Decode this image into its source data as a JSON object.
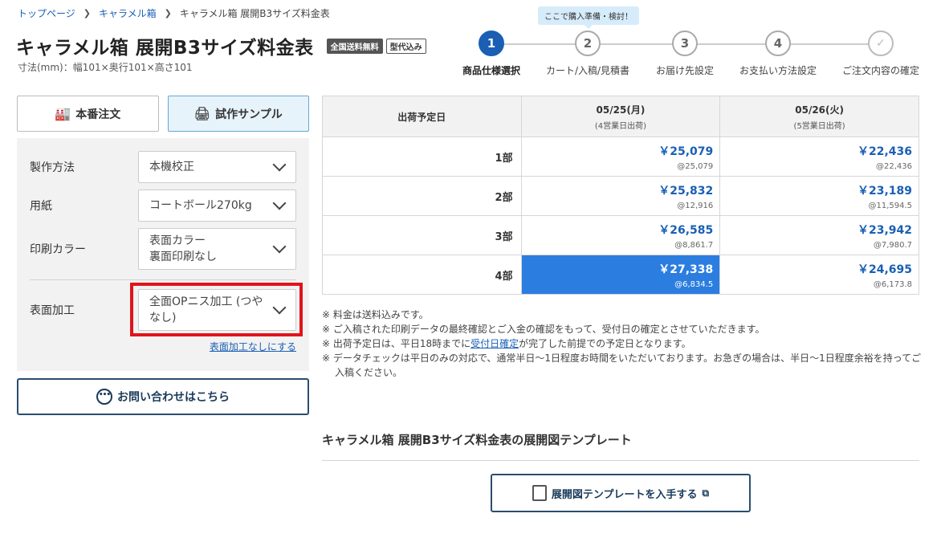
{
  "breadcrumb": {
    "items": [
      "トップページ",
      "キャラメル箱",
      "キャラメル箱 展開B3サイズ料金表"
    ]
  },
  "header": {
    "title": "キャラメル箱 展開B3サイズ料金表",
    "badge_free_shipping": "全国送料無料",
    "badge_die_included": "型代込み",
    "dimension": "寸法(mm)：幅101×奥行101×高さ101"
  },
  "steps": {
    "note": "ここで購入準備・検討！",
    "items": [
      {
        "number": "1",
        "label": "商品仕様選択",
        "state": "active"
      },
      {
        "number": "2",
        "label": "カート/入稿/見積書",
        "state": "pending"
      },
      {
        "number": "3",
        "label": "お届け先設定",
        "state": "pending"
      },
      {
        "number": "4",
        "label": "お支払い方法設定",
        "state": "pending"
      },
      {
        "number": "✓",
        "label": "ご注文内容の確定",
        "state": "final"
      }
    ]
  },
  "mode_tabs": {
    "production": "本番注文",
    "sample": "試作サンプル",
    "selected": "sample"
  },
  "spec": {
    "method": {
      "label": "製作方法",
      "value": "本機校正"
    },
    "paper": {
      "label": "用紙",
      "value": "コートボール270kg"
    },
    "color": {
      "label": "印刷カラー",
      "value_line1": "表面カラー",
      "value_line2": "裏面印刷なし"
    },
    "finish": {
      "label": "表面加工",
      "value": "全面OPニス加工 (つやなし)"
    },
    "no_finish_link": "表面加工なしにする"
  },
  "contact_button": "お問い合わせはこちら",
  "price_table": {
    "corner_label": "出荷予定日",
    "columns": [
      {
        "date": "05/25(月)",
        "note": "(4営業日出荷)"
      },
      {
        "date": "05/26(火)",
        "note": "(5営業日出荷)"
      }
    ],
    "rows": [
      {
        "qty": "1部",
        "prices": [
          {
            "amount": "￥25,079",
            "unit": "@25,079"
          },
          {
            "amount": "￥22,436",
            "unit": "@22,436"
          }
        ]
      },
      {
        "qty": "2部",
        "prices": [
          {
            "amount": "￥25,832",
            "unit": "@12,916"
          },
          {
            "amount": "￥23,189",
            "unit": "@11,594.5"
          }
        ]
      },
      {
        "qty": "3部",
        "prices": [
          {
            "amount": "￥26,585",
            "unit": "@8,861.7"
          },
          {
            "amount": "￥23,942",
            "unit": "@7,980.7"
          }
        ]
      },
      {
        "qty": "4部",
        "prices": [
          {
            "amount": "￥27,338",
            "unit": "@6,834.5"
          },
          {
            "amount": "￥24,695",
            "unit": "@6,173.8"
          }
        ]
      }
    ],
    "selected_row": 3,
    "selected_col": 0
  },
  "notes": {
    "n1": "※ 料金は送料込みです。",
    "n2": "※ ご入稿された印刷データの最終確認とご入金の確認をもって、受付日の確定とさせていただきます。",
    "n3_pre": "※ 出荷予定日は、平日18時までに",
    "n3_link": "受付日確定",
    "n3_post": "が完了した前提での予定日となります。",
    "n4": "※ データチェックは平日のみの対応で、通常半日〜1日程度お時間をいただいております。お急ぎの場合は、半日〜1日程度余裕を持ってご入稿ください。"
  },
  "template_section": {
    "heading": "キャラメル箱 展開B3サイズ料金表の展開図テンプレート",
    "button": "展開図テンプレートを入手する"
  },
  "colors": {
    "accent": "#1a5fb4",
    "selected_cell": "#2b7de0",
    "highlight": "#e0141a"
  }
}
